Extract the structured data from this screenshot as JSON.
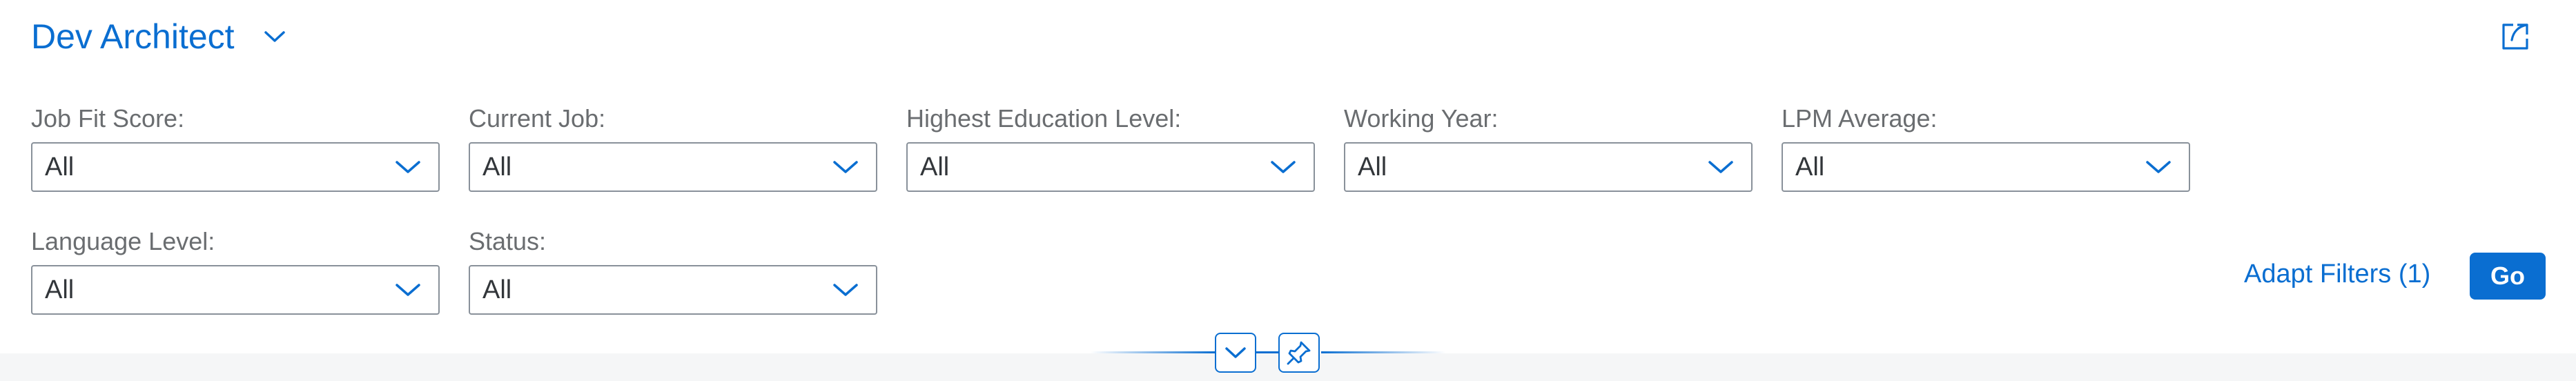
{
  "header": {
    "title": "Dev Architect",
    "title_icon": "chevron-down-icon",
    "share_icon": "share-icon"
  },
  "filters": [
    {
      "label": "Job Fit Score:",
      "value": "All"
    },
    {
      "label": "Current Job:",
      "value": "All"
    },
    {
      "label": "Highest Education Level:",
      "value": "All"
    },
    {
      "label": "Working Year:",
      "value": "All"
    },
    {
      "label": "LPM Average:",
      "value": "All"
    },
    {
      "label": "Language Level:",
      "value": "All"
    },
    {
      "label": "Status:",
      "value": "All"
    }
  ],
  "actions": {
    "adapt_filters": "Adapt Filters (1)",
    "go": "Go"
  },
  "toggles": {
    "collapse_icon": "chevron-down-icon",
    "pin_icon": "pin-icon"
  },
  "colors": {
    "accent": "#0a6ed1",
    "label": "#6a6d70",
    "border": "#89919a",
    "band": "#f5f6f7"
  }
}
